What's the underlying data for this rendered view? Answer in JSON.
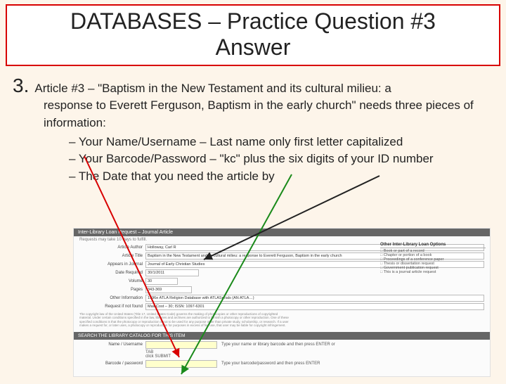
{
  "title": {
    "line1": "DATABASES – Practice Question #3",
    "line2": "Answer"
  },
  "question": {
    "number": "3.",
    "lead": "Article #3 – \"Baptism in the New Testament and its cultural milieu: a",
    "cont": "response to Everett Ferguson, Baptism in the early church\" needs three pieces of information:",
    "bullets": [
      "Your Name/Username – Last name only first letter capitalized",
      "Your Barcode/Password – \"kc\" plus the six digits of your ID number",
      "The Date that you need the article by"
    ]
  },
  "form": {
    "header": "Inter-Library Loan Request – Journal Article",
    "note": "Requests may take 10 days to fulfill.",
    "rows": [
      {
        "label": "Article Author",
        "value": "Holloway, Carl R"
      },
      {
        "label": "Article Title",
        "value": "Baptism in the New Testament and its cultural milieu: a response to Everett Ferguson, Baptism in the early church"
      },
      {
        "label": "Appears in Journal",
        "value": "Journal of Early Christian Studies"
      },
      {
        "label": "Date Required",
        "value": "30/1/2011"
      },
      {
        "label": "Volume",
        "value": "30"
      },
      {
        "label": "Pages",
        "value": "343-369"
      },
      {
        "label": "Other Information",
        "value": "1996e ATLA Religion Database with ATLASerials (AN ATLA…)"
      },
      {
        "label": "Request if not found",
        "value": "Max Cost – 30; ISSN: 1097-6301"
      }
    ],
    "right": {
      "heading": "Other Inter-Library Loan Options",
      "options": [
        "Book or part of a record",
        "Chapter or portion of a book",
        "Proceedings of a conference paper",
        "Thesis or dissertation request",
        "Government publication request",
        "This is a journal article request"
      ]
    },
    "copyright": "The copyright law of the United States (Title 17, United States Code) governs the making of photocopies or other reproductions of copyrighted material. Under certain conditions specified in the law, libraries and archives are authorized to furnish a photocopy or other reproduction. One of these specified conditions is that the photocopy or reproduction is not to be used for any purpose other than private study, scholarship, or research. If a user makes a request for, or later uses, a photocopy or reproduction for purposes in excess of fair use, that user may be liable for copyright infringement.",
    "search_header": "SEARCH THE LIBRARY CATALOG FOR THIS ITEM",
    "login": {
      "name_label": "Name / Username",
      "name_hint": "Type your name or library barcode and then press ENTER or",
      "tab": "TAB",
      "submit": "click SUBMIT",
      "barcode_label": "Barcode / password",
      "barcode_hint": "Type your barcode/password and then press ENTER"
    }
  }
}
